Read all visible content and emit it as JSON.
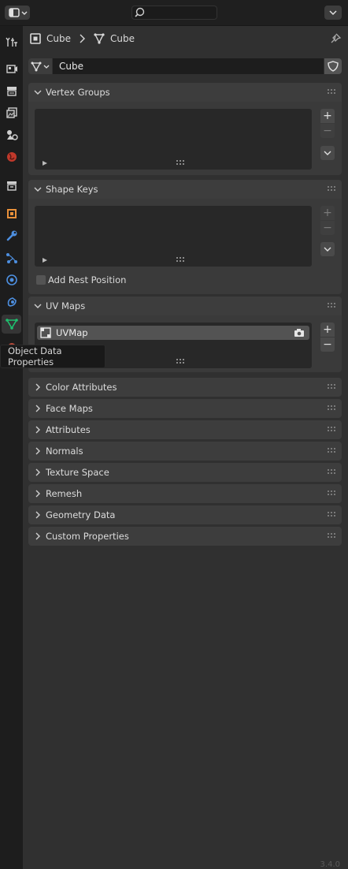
{
  "header": {
    "search_placeholder": ""
  },
  "breadcrumb": {
    "object_name": "Cube",
    "mesh_name": "Cube"
  },
  "datablock": {
    "name": "Cube"
  },
  "panels": {
    "vertex_groups": {
      "label": "Vertex Groups"
    },
    "shape_keys": {
      "label": "Shape Keys",
      "add_rest_position_label": "Add Rest Position"
    },
    "uv_maps": {
      "label": "UV Maps",
      "items": [
        {
          "name": "UVMap"
        }
      ]
    },
    "collapsed": [
      {
        "label": "Color Attributes"
      },
      {
        "label": "Face Maps"
      },
      {
        "label": "Attributes"
      },
      {
        "label": "Normals"
      },
      {
        "label": "Texture Space"
      },
      {
        "label": "Remesh"
      },
      {
        "label": "Geometry Data"
      },
      {
        "label": "Custom Properties"
      }
    ]
  },
  "tooltip": {
    "text": "Object Data Properties"
  },
  "version": {
    "text": "3.4.0"
  },
  "colors": {
    "active_tab_icon": "#1fbf6f",
    "background": "#303030",
    "header": "#3d3d3d"
  }
}
